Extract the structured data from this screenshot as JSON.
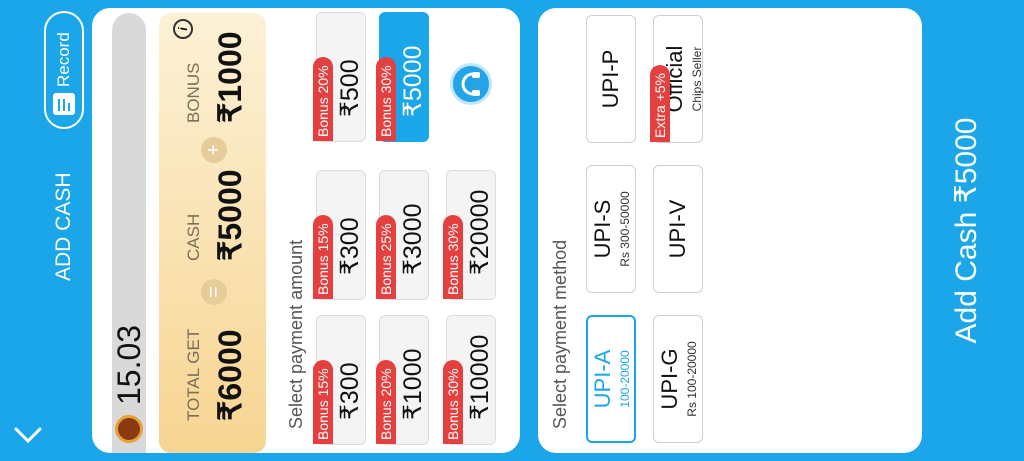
{
  "header": {
    "title": "ADD CASH",
    "record_label": "Record"
  },
  "balance": {
    "value": "15.03"
  },
  "summary": {
    "total_label": "TOTAL GET",
    "total_value": "₹6000",
    "cash_label": "CASH",
    "cash_value": "₹5000",
    "bonus_label": "BONUS",
    "bonus_value": "₹1000",
    "equals": "=",
    "plus": "+",
    "info": "i"
  },
  "amounts": {
    "section_label": "Select payment amount",
    "items": [
      {
        "amount": "₹300",
        "bonus": "Bonus 15%"
      },
      {
        "amount": "₹300",
        "bonus": "Bonus 15%"
      },
      {
        "amount": "₹500",
        "bonus": "Bonus 20%"
      },
      {
        "amount": "₹1000",
        "bonus": "Bonus 20%"
      },
      {
        "amount": "₹3000",
        "bonus": "Bonus 25%"
      },
      {
        "amount": "₹5000",
        "bonus": "Bonus 30%",
        "selected": true
      },
      {
        "amount": "₹10000",
        "bonus": "Bonus 30%"
      },
      {
        "amount": "₹20000",
        "bonus": "Bonus 30%"
      }
    ]
  },
  "methods": {
    "section_label": "Select payment method",
    "items": [
      {
        "name": "UPI-A",
        "sub": "100-20000",
        "selected": true
      },
      {
        "name": "UPI-S",
        "sub": "Rs 300-50000"
      },
      {
        "name": "UPI-P",
        "sub": ""
      },
      {
        "name": "UPI-G",
        "sub": "Rs 100-20000"
      },
      {
        "name": "UPI-V",
        "sub": ""
      },
      {
        "name": "Official",
        "sub": "Chips Seller",
        "badge": "Extra +5%"
      }
    ]
  },
  "cta": {
    "label": "Add Cash ₹5000"
  },
  "colors": {
    "accent": "#1aa6e9",
    "badge": "#e3403f",
    "summary_bg": "#f7d592"
  }
}
